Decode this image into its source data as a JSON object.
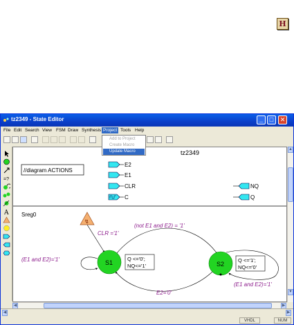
{
  "corner_icon": {
    "glyph": "H",
    "icon": "hdl-document-icon"
  },
  "window": {
    "title": "tz2349 - State Editor",
    "buttons": {
      "minimize": "_",
      "maximize": "□",
      "close": "✕"
    }
  },
  "menu": {
    "items": [
      {
        "label": "File"
      },
      {
        "label": "Edit"
      },
      {
        "label": "Search"
      },
      {
        "label": "View"
      },
      {
        "label": "FSM"
      },
      {
        "label": "Draw"
      },
      {
        "label": "Synthesis"
      },
      {
        "label": "Project"
      },
      {
        "label": "Tools"
      },
      {
        "label": "Help"
      }
    ],
    "open_menu": "Project",
    "dropdown": [
      {
        "label": "Add to Project",
        "state": "disabled"
      },
      {
        "label": "Create Macro",
        "state": "disabled"
      },
      {
        "label": "Update Macro",
        "state": "selected"
      }
    ]
  },
  "diagram": {
    "title": "tz2349",
    "actions_label": "//diagram ACTIONS",
    "inputs": [
      "E2",
      "E1",
      "CLR",
      "C"
    ],
    "outputs": [
      "NQ",
      "Q"
    ],
    "sreg_label": "Sreg0",
    "states": [
      {
        "name": "S1",
        "actions": [
          "Q <='0';",
          "NQ<='1'"
        ]
      },
      {
        "name": "S2",
        "actions": [
          "Q <='1';",
          "NQ<='0'"
        ]
      }
    ],
    "transitions": {
      "reset": "CLR ='1'",
      "s1_to_s2": "(not E1 and E2) = '1'",
      "s1_self": "(E1 and E2)='1'",
      "s2_self": "(E1 and E2)='1'",
      "s2_to_s1": "E2='0'"
    },
    "reset_glyph": "↯",
    "colors": {
      "state_fill": "#22d422",
      "port_fill": "#33e6f0",
      "text_purple": "#8b1a8b",
      "reset_fill": "#f5b070"
    }
  },
  "statusbar": {
    "lang": "VHDL",
    "num": "NUM"
  }
}
